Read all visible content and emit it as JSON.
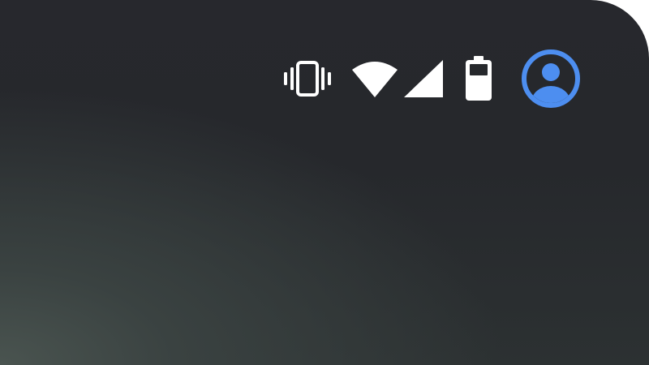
{
  "screen": {
    "background": "#27282d"
  },
  "status_bar": {
    "icons": [
      {
        "name": "vibrate-icon",
        "color": "#ffffff"
      },
      {
        "name": "wifi-icon",
        "color": "#ffffff"
      },
      {
        "name": "cell-signal-icon",
        "color": "#ffffff"
      },
      {
        "name": "battery-icon",
        "color": "#ffffff"
      },
      {
        "name": "user-avatar-icon",
        "color": "#4d8ef0"
      }
    ]
  }
}
